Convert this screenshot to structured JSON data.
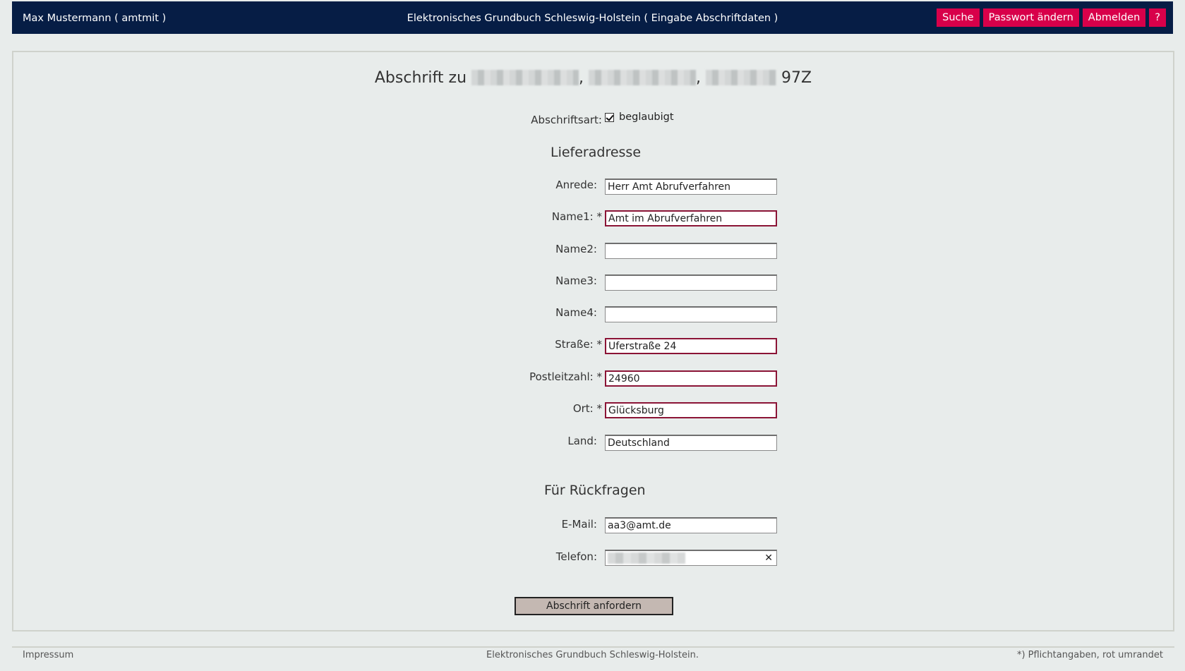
{
  "header": {
    "user": "Max Mustermann  ( amtmit )",
    "app_title": "Elektronisches Grundbuch Schleswig-Holstein  ( Eingabe Abschriftdaten )",
    "nav": {
      "search": "Suche",
      "change_password": "Passwort ändern",
      "logout": "Abmelden",
      "help": "?"
    }
  },
  "form": {
    "title_prefix": "Abschrift zu",
    "title_sep": ",",
    "title_suffix": "97Z",
    "copy_type_label": "Abschriftsart:",
    "copy_type_option": "beglaubigt",
    "delivery_heading": "Lieferadresse",
    "fields": {
      "anrede": {
        "label": "Anrede:",
        "value": "Herr Amt Abrufverfahren"
      },
      "name1": {
        "label": "Name1: *",
        "value": "Amt im Abrufverfahren"
      },
      "name2": {
        "label": "Name2:",
        "value": ""
      },
      "name3": {
        "label": "Name3:",
        "value": ""
      },
      "name4": {
        "label": "Name4:",
        "value": ""
      },
      "strasse": {
        "label": "Straße: *",
        "value": "Uferstraße 24"
      },
      "plz": {
        "label": "Postleitzahl: *",
        "value": "24960"
      },
      "ort": {
        "label": "Ort: *",
        "value": "Glücksburg"
      },
      "land": {
        "label": "Land:",
        "value": "Deutschland"
      }
    },
    "contact_heading": "Für Rückfragen",
    "contact": {
      "email": {
        "label": "E-Mail:",
        "value": "aa3@amt.de"
      },
      "telefon": {
        "label": "Telefon:"
      }
    },
    "submit_label": "Abschrift anfordern"
  },
  "footer": {
    "impressum": "Impressum",
    "center": "Elektronisches Grundbuch Schleswig-Holstein.",
    "note": "*) Pflichtangaben, rot umrandet"
  },
  "colors": {
    "header_bg": "#061d45",
    "nav_button_bg": "#d8004a",
    "required_border": "#8b1436",
    "submit_bg": "#c4b8b2"
  }
}
